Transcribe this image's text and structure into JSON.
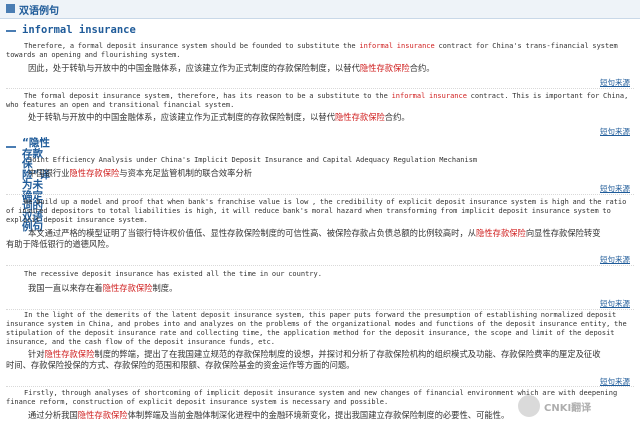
{
  "header": {
    "title": "双语例句"
  },
  "source_link": "短句来源",
  "sections": [
    {
      "title": "informal insurance",
      "items": [
        {
          "en": "Therefore, a formal deposit insurance system should be founded to substitute the informal insurance contract for China's trans-financial system towards an opening and flourishing system.",
          "zh": "因此，处于转轨与开放中的中国金融体系，应该建立作为正式制度的存款保险制度，以替代隐性存款保险合约。"
        },
        {
          "en": "The formal deposit insurance system, therefore, has its reason to be a substitute to the informal insurance contract. This is important for China, who features an open and transitional financial system.",
          "zh": "处于转轨与开放中的中国金融体系，应该建立作为正式制度的存款保险制度，以替代隐性存款保险合约。"
        }
      ]
    },
    {
      "title": "“隐性存款保险”译为未确定词的双语例句",
      "items": [
        {
          "en": "Joint Efficiency Analysis under China's Implicit Deposit Insurance and Capital Adequacy Regulation Mechanism",
          "zh": "中国银行业隐性存款保险与资本充足监管机制的联合效率分析"
        },
        {
          "en": "We build up a model and proof that when bank's franchise value is low , the credibility of explicit deposit insurance system is high and the ratio of insured depositors to total liabilities is high, it will reduce bank's moral hazard when transforming from implicit deposit insurance system to explicit deposit insurance system.",
          "zh": "本文通过严格的模型证明了当银行特许权价值低、显性存款保险制度的可信性高、被保险存款占负债总额的比例较高时，从隐性存款保险向显性存款保险转变有助于降低银行的道德风险。"
        },
        {
          "en": "The recessive deposit insurance has existed all the time in our country.",
          "zh": "我国一直以来存在着隐性存款保险制度。"
        },
        {
          "en": "In the light of the demerits of the latent deposit insurance system, this paper puts forward the presumption of establishing normalized deposit insurance system in China, and probes into and analyzes on the problems of the organizational modes and functions of the deposit insurance entity, the stipulation of the deposit insurance rate and collecting time, the application method for the deposit insurance, the scope and limit of the deposit insurance, and the cash flow of the deposit insurance funds, etc.",
          "zh": "针对隐性存款保险制度的弊端，提出了在我国建立规范的存款保险制度的设想，并探讨和分析了存款保险机构的组织模式及功能、存款保险费率的厘定及征收时间、存款保险投保的方式、存款保险的范围和限额、存款保险基金的资金运作等方面的问题。"
        },
        {
          "en": "Firstly, through analyses of shortcoming of implicit deposit insurance system and new changes of financial environment which are with deepening finance reform, construction of explicit deposit insurance system is necessary and possible.",
          "zh": "通过分析我国隐性存款保险体制弊端及当前金融体制深化进程中的金融环境新变化，提出我国建立存款保险制度的必要性、可能性。"
        }
      ]
    }
  ],
  "watermark": "CNKI翻译"
}
